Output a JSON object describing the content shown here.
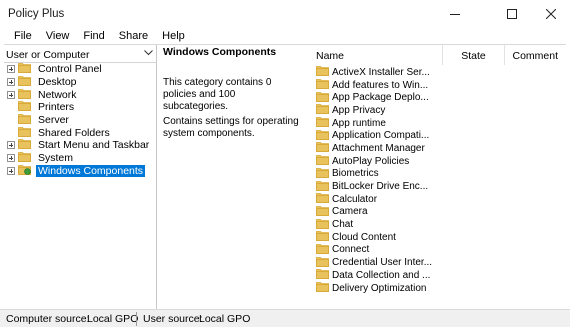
{
  "window": {
    "title": "Policy Plus"
  },
  "menu": [
    "File",
    "View",
    "Find",
    "Share",
    "Help"
  ],
  "tree": {
    "header": "User or Computer",
    "items": [
      {
        "label": "Control Panel",
        "expandable": true
      },
      {
        "label": "Desktop",
        "expandable": true
      },
      {
        "label": "Network",
        "expandable": true
      },
      {
        "label": "Printers",
        "expandable": false
      },
      {
        "label": "Server",
        "expandable": false
      },
      {
        "label": "Shared Folders",
        "expandable": false
      },
      {
        "label": "Start Menu and Taskbar",
        "expandable": true
      },
      {
        "label": "System",
        "expandable": true
      },
      {
        "label": "Windows Components",
        "expandable": true,
        "selected": true
      }
    ]
  },
  "details": {
    "title": "Windows Components",
    "summary": "This category contains 0 policies and 100 subcategories.",
    "help": "Contains settings for operating system components."
  },
  "list": {
    "columns": {
      "name": "Name",
      "state": "State",
      "comment": "Comment"
    },
    "rows": [
      "ActiveX Installer Ser...",
      "Add features to Win...",
      "App Package Deplo...",
      "App Privacy",
      "App runtime",
      "Application Compati...",
      "Attachment Manager",
      "AutoPlay Policies",
      "Biometrics",
      "BitLocker Drive Enc...",
      "Calculator",
      "Camera",
      "Chat",
      "Cloud Content",
      "Connect",
      "Credential User Inter...",
      "Data Collection and ...",
      "Delivery Optimization"
    ]
  },
  "status": {
    "computer_label": "Computer source:",
    "computer_value": "Local GPO",
    "user_label": "User source:",
    "user_value": "Local GPO"
  },
  "colors": {
    "selection": "#0078d7",
    "folder": "#e8c35d",
    "folder_dark": "#d6a630"
  }
}
